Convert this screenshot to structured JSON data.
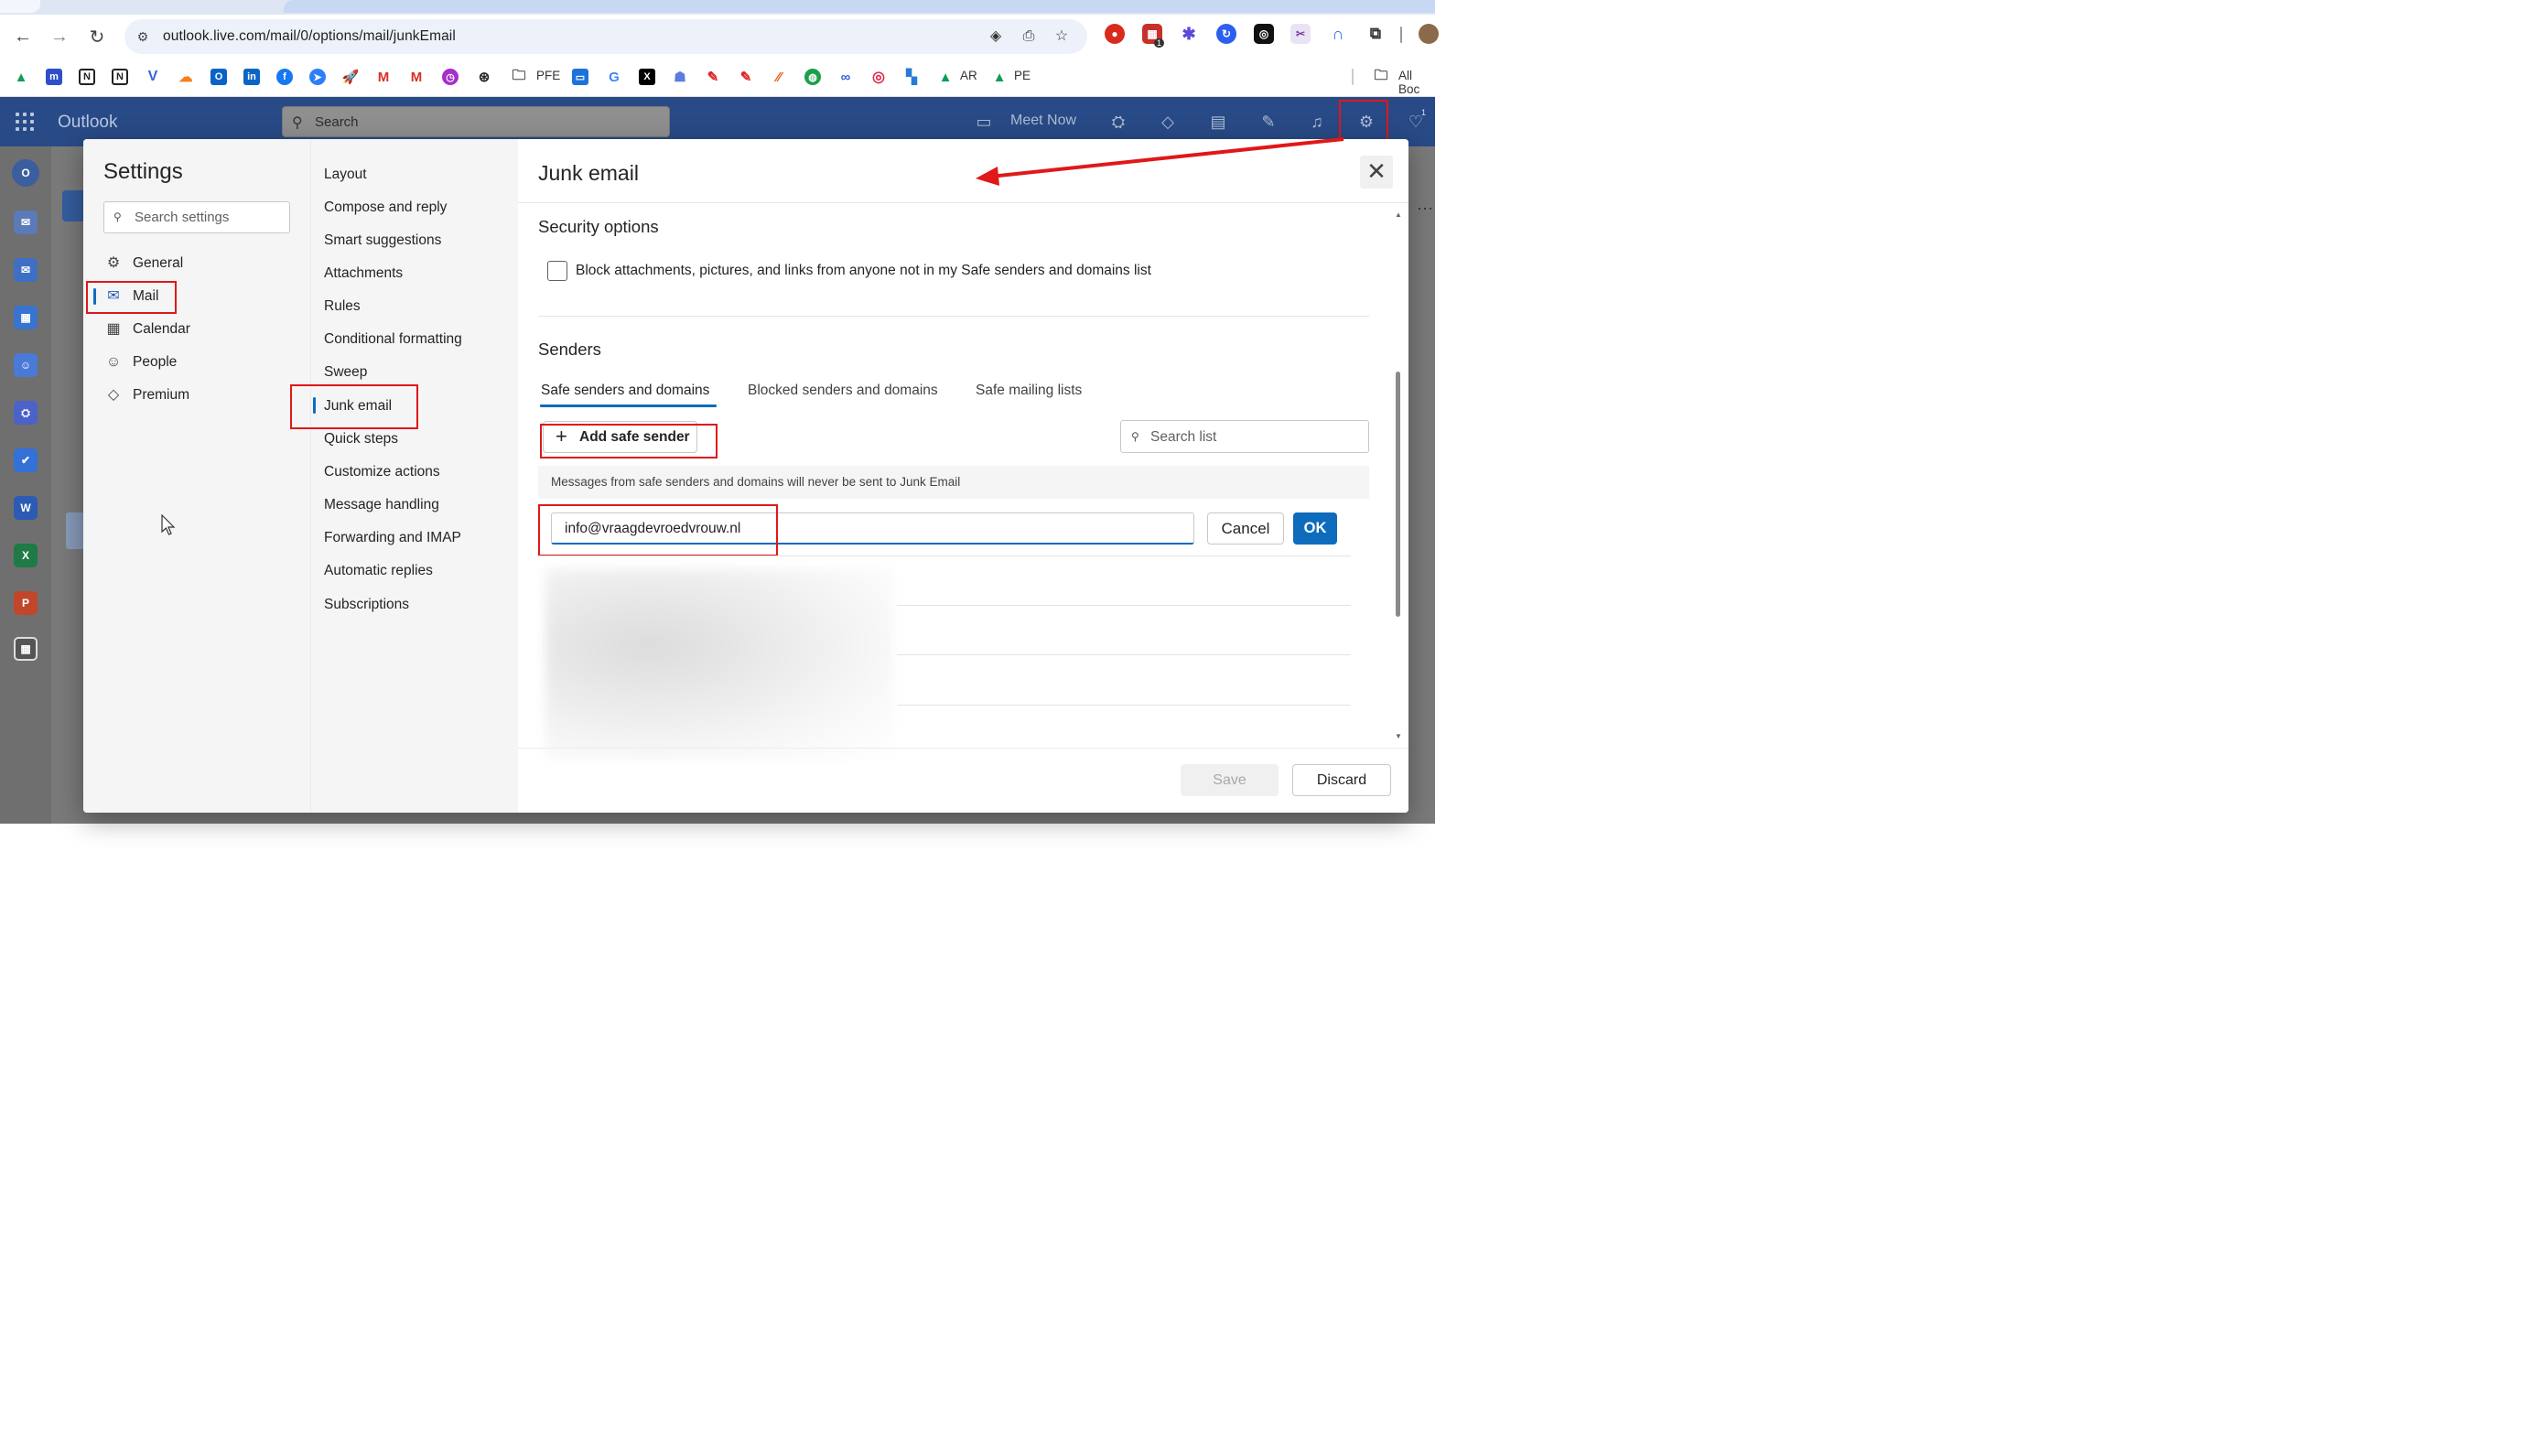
{
  "browser": {
    "url": "outlook.live.com/mail/0/options/mail/junkEmail",
    "nav": {
      "back": "←",
      "forward": "→",
      "reload": "↻"
    },
    "bookmarks": {
      "pfe": "PFE",
      "ar": "AR",
      "pe": "PE",
      "all_bookmarks": "All Boc"
    },
    "extension_badge": "1"
  },
  "outlook": {
    "brand": "Outlook",
    "search_placeholder": "Search",
    "meet_now": "Meet Now",
    "notification_badge": "1"
  },
  "settings": {
    "title": "Settings",
    "search_placeholder": "Search settings",
    "categories": [
      {
        "label": "General",
        "icon": "gear-icon"
      },
      {
        "label": "Mail",
        "icon": "mail-icon",
        "selected": true
      },
      {
        "label": "Calendar",
        "icon": "calendar-icon"
      },
      {
        "label": "People",
        "icon": "people-icon"
      },
      {
        "label": "Premium",
        "icon": "diamond-icon"
      }
    ],
    "mail_sections": [
      "Layout",
      "Compose and reply",
      "Smart suggestions",
      "Attachments",
      "Rules",
      "Conditional formatting",
      "Sweep",
      "Junk email",
      "Quick steps",
      "Customize actions",
      "Message handling",
      "Forwarding and IMAP",
      "Automatic replies",
      "Subscriptions"
    ],
    "selected_section": "Junk email"
  },
  "junk": {
    "title": "Junk email",
    "security_title": "Security options",
    "block_label": "Block attachments, pictures, and links from anyone not in my Safe senders and domains list",
    "block_checked": false,
    "senders_title": "Senders",
    "tabs": [
      {
        "label": "Safe senders and domains",
        "active": true
      },
      {
        "label": "Blocked senders and domains",
        "active": false
      },
      {
        "label": "Safe mailing lists",
        "active": false
      }
    ],
    "add_button": "Add safe sender",
    "search_list_placeholder": "Search list",
    "info_text": "Messages from safe senders and domains will never be sent to Junk Email",
    "sender_input_value": "info@vraagdevroedvrouw.nl",
    "cancel": "Cancel",
    "ok": "OK",
    "save": "Save",
    "discard": "Discard"
  },
  "colors": {
    "outlook_header": "#284a86",
    "accent": "#0f6cbd",
    "annotation_red": "#e01818"
  }
}
